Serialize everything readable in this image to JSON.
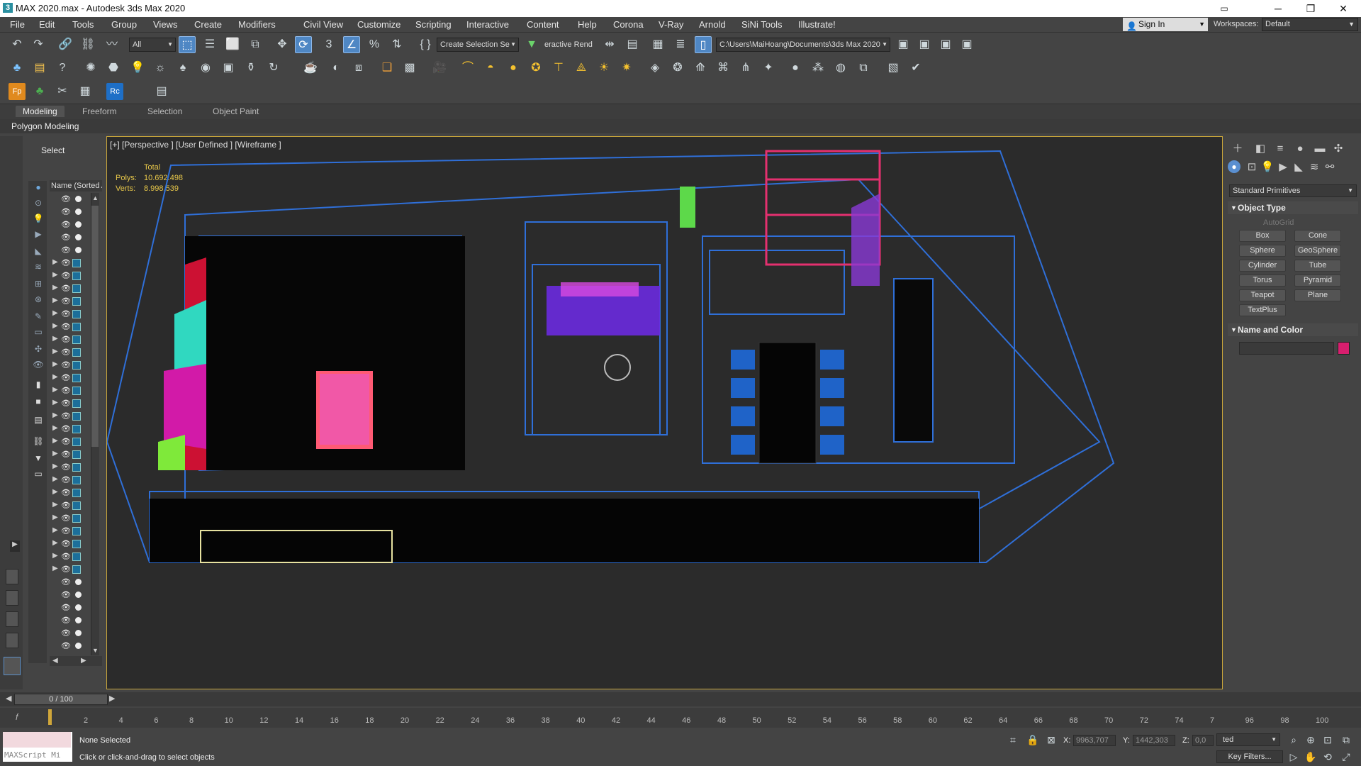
{
  "window": {
    "title": "MAX 2020.max - Autodesk 3ds Max 2020",
    "app_icon": "3",
    "minimize": "─",
    "maximize": "❐",
    "close": "✕",
    "restore_extra": "▭"
  },
  "menu": [
    "File",
    "Edit",
    "Tools",
    "Group",
    "Views",
    "Create",
    "Modifiers",
    "Civil View",
    "Customize",
    "Scripting",
    "Interactive",
    "Content",
    "Help",
    "Corona",
    "V-Ray",
    "Arnold",
    "SiNi Tools",
    "Illustrate!"
  ],
  "account": {
    "sign_in": "Sign In",
    "workspaces_label": "Workspaces:",
    "workspace_value": "Default"
  },
  "toolbar": {
    "filter_value": "All",
    "selection_set_placeholder": "Create Selection Se",
    "interactive_render": "eractive Rend",
    "project_path": "C:\\Users\\MaiHoang\\Documents\\3ds Max 2020"
  },
  "ribbon": {
    "tabs": [
      "Modeling",
      "Freeform",
      "Selection",
      "Object Paint"
    ],
    "active": "Modeling",
    "panel": "Polygon Modeling"
  },
  "scene_explorer": {
    "title": "Select",
    "column_header": "Name (Sorted A",
    "rows": 36
  },
  "viewport": {
    "label": "[+] [Perspective ] [User Defined ] [Wireframe ]",
    "stats_total": "Total",
    "polys_label": "Polys:",
    "polys_value": "10.692.498",
    "verts_label": "Verts:",
    "verts_value": "8.998.539"
  },
  "command_panel": {
    "category": "Standard Primitives",
    "object_type_header": "Object Type",
    "autogrid": "AutoGrid",
    "primitives": [
      "Box",
      "Cone",
      "Sphere",
      "GeoSphere",
      "Cylinder",
      "Tube",
      "Torus",
      "Pyramid",
      "Teapot",
      "Plane",
      "TextPlus"
    ],
    "name_color_header": "Name and Color",
    "object_color": "#d81e6e"
  },
  "timeline": {
    "frame_display": "0 / 100",
    "ticks": [
      "2",
      "4",
      "6",
      "8",
      "10",
      "12",
      "14",
      "16",
      "18",
      "20",
      "22",
      "24",
      "36",
      "38",
      "40",
      "42",
      "44",
      "46",
      "48",
      "50",
      "52",
      "54",
      "56",
      "58",
      "60",
      "62",
      "64",
      "66",
      "68",
      "70",
      "72",
      "74",
      "7",
      "96",
      "98",
      "100"
    ]
  },
  "status": {
    "maxscript": "MAXScript Mi",
    "selection": "None Selected",
    "hint": "Click or click-and-drag to select objects",
    "x_label": "X:",
    "x_value": "9963,707",
    "y_label": "Y:",
    "y_value": "1442,303",
    "z_label": "Z:",
    "z_value": "0,0",
    "selected_dd": "ted",
    "key_filters": "Key Filters..."
  }
}
